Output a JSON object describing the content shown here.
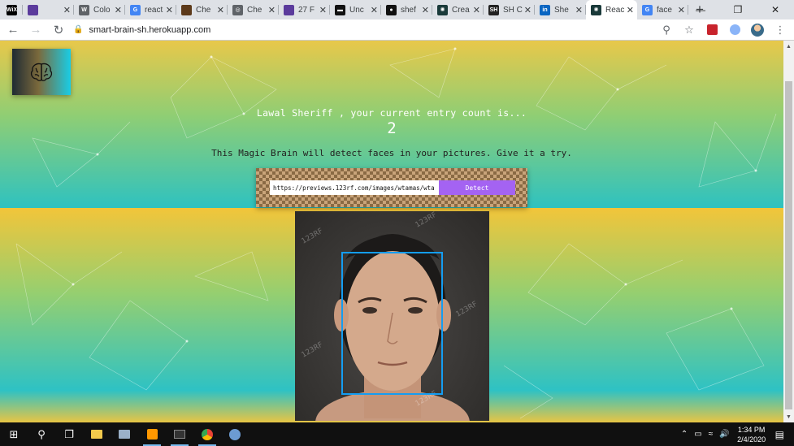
{
  "browser": {
    "tabs": [
      {
        "label": "",
        "favicon": "wix-icon",
        "color": "#000000",
        "glyph": "WiX"
      },
      {
        "label": "",
        "favicon": "purple-app-icon",
        "color": "#5b3b9c",
        "glyph": ""
      },
      {
        "label": "Colo",
        "favicon": "wordpress-icon",
        "color": "#5f6368",
        "glyph": "W"
      },
      {
        "label": "react",
        "favicon": "google-icon",
        "color": "#4285f4",
        "glyph": "G"
      },
      {
        "label": "Che",
        "favicon": "bookmark-icon",
        "color": "#5d3a1a",
        "glyph": ""
      },
      {
        "label": "Che",
        "favicon": "globe-icon",
        "color": "#5f6368",
        "glyph": "◎"
      },
      {
        "label": "27 F",
        "favicon": "purple-app-icon",
        "color": "#5b3b9c",
        "glyph": ""
      },
      {
        "label": "Unc",
        "favicon": "unsplash-icon",
        "color": "#111111",
        "glyph": "▬"
      },
      {
        "label": "shef",
        "favicon": "github-icon",
        "color": "#111111",
        "glyph": "●"
      },
      {
        "label": "Crea",
        "favicon": "react-icon",
        "color": "#1a3a3a",
        "glyph": "✺"
      },
      {
        "label": "SH C",
        "favicon": "sh-icon",
        "color": "#222222",
        "glyph": "SH"
      },
      {
        "label": "She",
        "favicon": "linkedin-icon",
        "color": "#0a66c2",
        "glyph": "in"
      },
      {
        "label": "Reac",
        "favicon": "react-icon",
        "color": "#1a3a3a",
        "glyph": "✺",
        "active": true
      },
      {
        "label": "face",
        "favicon": "google-icon",
        "color": "#4285f4",
        "glyph": "G"
      }
    ],
    "new_tab": "+",
    "url": "smart-brain-sh.herokuapp.com"
  },
  "page": {
    "greeting": "Lawal Sheriff , your current entry count is...",
    "entry_count": "2",
    "tagline": "This Magic Brain will detect faces in your pictures. Give it a try.",
    "image_url_value": "https://previews.123rf.com/images/wtamas/wta",
    "detect_label": "Detect",
    "watermark": "123RF"
  },
  "taskbar": {
    "time": "1:34 PM",
    "date": "2/4/2020"
  },
  "colors": {
    "detect_button": "#a463f2",
    "face_box": "#149df2"
  }
}
